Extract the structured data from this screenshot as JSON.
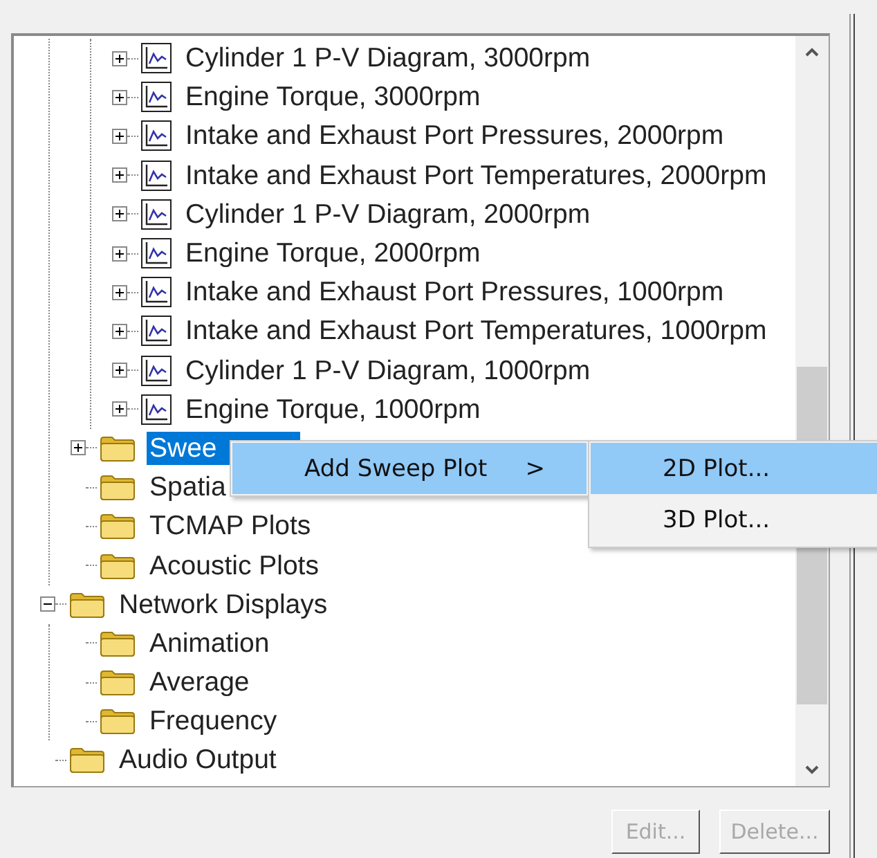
{
  "tree": {
    "items": [
      {
        "children": [
          {
            "children": [
              {
                "label": "Cylinder 1 P-V Diagram, 3000rpm",
                "kind": "plot",
                "expanded": false,
                "selected": false
              },
              {
                "label": "Engine Torque, 3000rpm",
                "kind": "plot",
                "expanded": false,
                "selected": false
              },
              {
                "label": "Intake and Exhaust Port Pressures, 2000rpm",
                "kind": "plot",
                "expanded": false,
                "selected": false
              },
              {
                "label": "Intake and Exhaust Port Temperatures, 2000rpm",
                "kind": "plot",
                "expanded": false,
                "selected": false
              },
              {
                "label": "Cylinder 1 P-V Diagram, 2000rpm",
                "kind": "plot",
                "expanded": false,
                "selected": false
              },
              {
                "label": "Engine Torque, 2000rpm",
                "kind": "plot",
                "expanded": false,
                "selected": false
              },
              {
                "label": "Intake and Exhaust Port Pressures, 1000rpm",
                "kind": "plot",
                "expanded": false,
                "selected": false
              },
              {
                "label": "Intake and Exhaust Port Temperatures, 1000rpm",
                "kind": "plot",
                "expanded": false,
                "selected": false
              },
              {
                "label": "Cylinder 1 P-V Diagram, 1000rpm",
                "kind": "plot",
                "expanded": false,
                "selected": false
              },
              {
                "label": "Engine Torque, 1000rpm",
                "kind": "plot",
                "expanded": false,
                "selected": false
              }
            ]
          },
          {
            "label": "Swee",
            "kind": "folder",
            "expanded": false,
            "selected": true
          },
          {
            "label": "Spatia",
            "kind": "folder",
            "selected": false
          },
          {
            "label": "TCMAP Plots",
            "kind": "folder",
            "selected": false
          },
          {
            "label": "Acoustic Plots",
            "kind": "folder",
            "selected": false
          }
        ]
      },
      {
        "label": "Network Displays",
        "kind": "folder",
        "expanded": true,
        "selected": false,
        "children": [
          {
            "label": "Animation",
            "kind": "folder",
            "selected": false
          },
          {
            "label": "Average",
            "kind": "folder",
            "selected": false
          },
          {
            "label": "Frequency",
            "kind": "folder",
            "selected": false
          }
        ]
      },
      {
        "label": "Audio Output",
        "kind": "folder",
        "selected": false
      }
    ]
  },
  "context_menu": {
    "items": [
      {
        "label": "Add Sweep Plot",
        "arrow": ">",
        "selected": true
      }
    ]
  },
  "submenu": {
    "items": [
      {
        "label": "2D Plot...",
        "selected": true
      },
      {
        "label": "3D Plot...",
        "selected": false
      }
    ]
  },
  "buttons": [
    {
      "label": "Edit...",
      "disabled": true
    },
    {
      "label": "Delete...",
      "disabled": true
    }
  ]
}
